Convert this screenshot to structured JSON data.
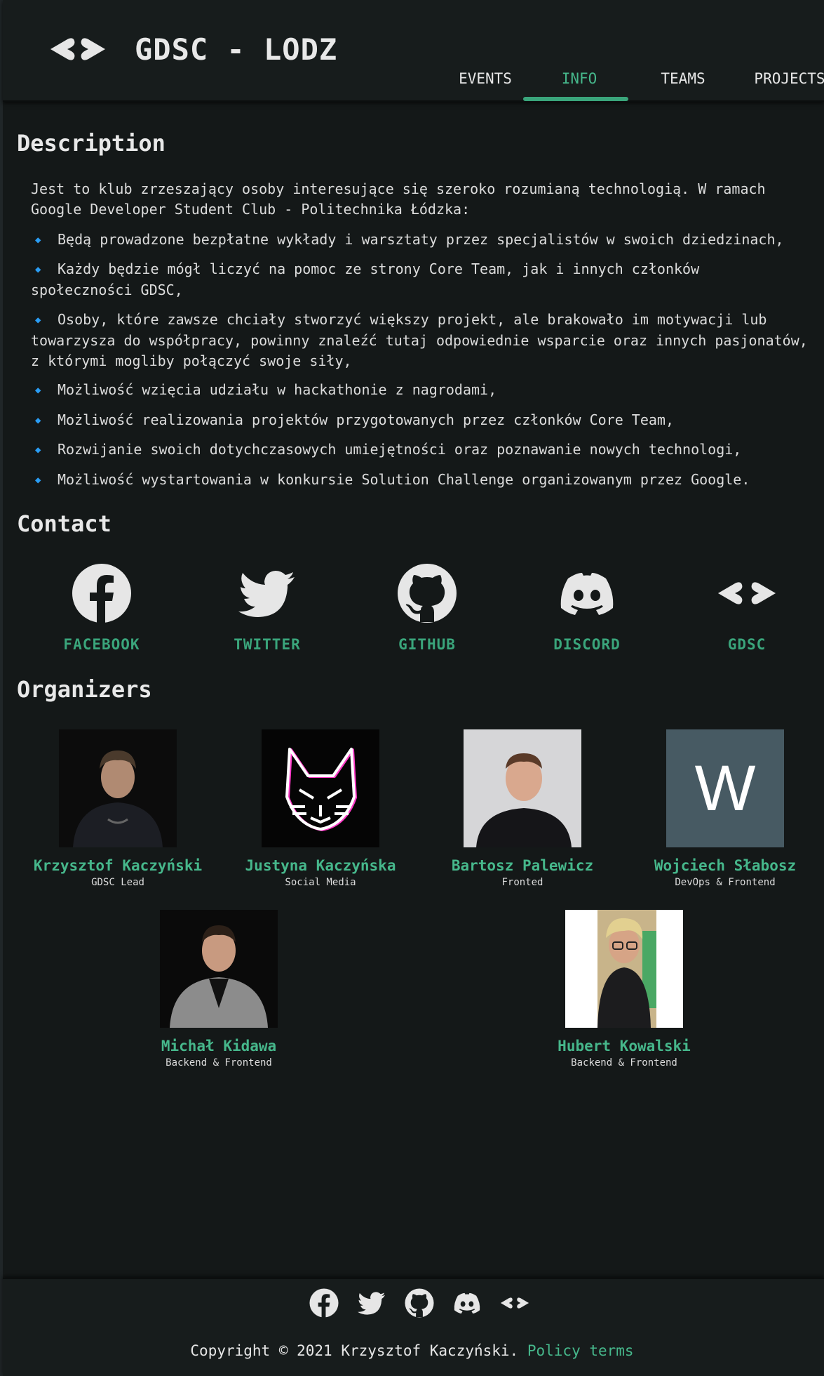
{
  "header": {
    "brand": "GDSC - LODZ",
    "nav": [
      {
        "label": "EVENTS",
        "active": false
      },
      {
        "label": "INFO",
        "active": true
      },
      {
        "label": "TEAMS",
        "active": false
      },
      {
        "label": "PROJECTS",
        "active": false
      }
    ]
  },
  "description": {
    "title": "Description",
    "intro": "Jest to klub zrzeszający osoby interesujące się szeroko rozumianą technologią. W ramach Google Developer Student Club - Politechnika Łódzka:",
    "bullets": [
      "Będą prowadzone bezpłatne wykłady i warsztaty przez specjalistów w swoich dziedzinach,",
      "Każdy będzie mógł liczyć na pomoc ze strony Core Team, jak i innych członków społeczności GDSC,",
      "Osoby, które zawsze chciały stworzyć większy projekt, ale brakowało im motywacji lub towarzysza do współpracy, powinny znaleźć tutaj odpowiednie wsparcie oraz innych pasjonatów, z którymi mogliby połączyć swoje siły,",
      "Możliwość wzięcia udziału w hackathonie z nagrodami,",
      "Możliwość realizowania projektów przygotowanych przez członków Core Team,",
      "Rozwijanie swoich dotychczasowych umiejętności oraz poznawanie nowych technologi,",
      "Możliwość wystartowania w konkursie Solution Challenge organizowanym przez Google."
    ]
  },
  "contact": {
    "title": "Contact",
    "items": [
      {
        "label": "FACEBOOK",
        "icon": "facebook-icon"
      },
      {
        "label": "TWITTER",
        "icon": "twitter-icon"
      },
      {
        "label": "GITHUB",
        "icon": "github-icon"
      },
      {
        "label": "DISCORD",
        "icon": "discord-icon"
      },
      {
        "label": "GDSC",
        "icon": "gdsc-icon"
      }
    ]
  },
  "organizers": {
    "title": "Organizers",
    "people": [
      {
        "name": "Krzysztof Kaczyński",
        "role": "GDSC Lead"
      },
      {
        "name": "Justyna Kaczyńska",
        "role": "Social Media"
      },
      {
        "name": "Bartosz Palewicz",
        "role": "Fronted"
      },
      {
        "name": "Wojciech Słabosz",
        "role": "DevOps & Frontend",
        "avatar_letter": "W"
      },
      {
        "name": "Michał Kidawa",
        "role": "Backend & Frontend"
      },
      {
        "name": "Hubert Kowalski",
        "role": "Backend & Frontend"
      }
    ]
  },
  "footer": {
    "copyright": "Copyright © 2021 Krzysztof Kaczyński.",
    "policy": "Policy terms"
  },
  "colors": {
    "background": "#141818",
    "header": "#171c1c",
    "accent": "#3aa57b",
    "bullet": "#2a9df4"
  }
}
